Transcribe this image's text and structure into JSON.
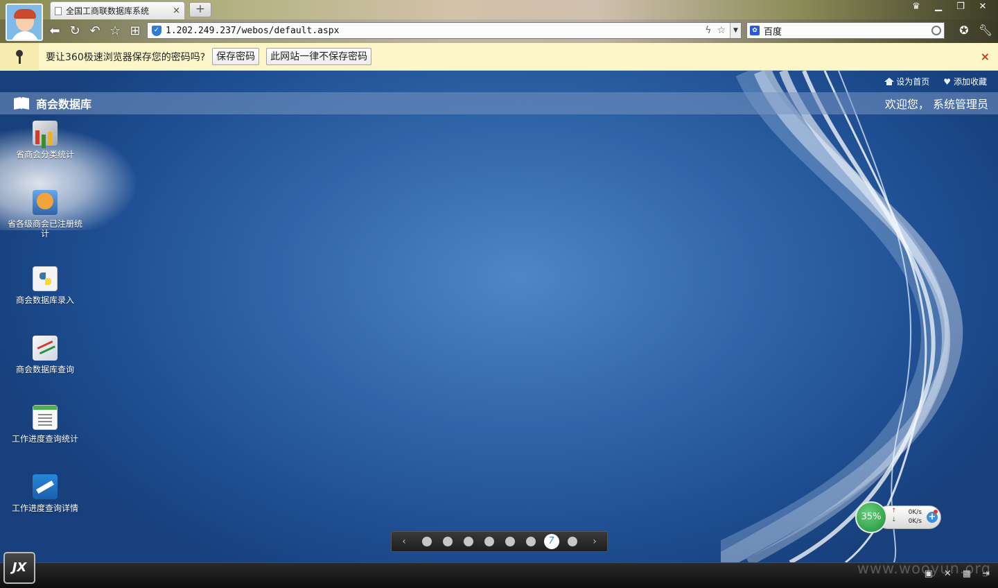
{
  "browser": {
    "tab_title": "全国工商联数据库系统",
    "tab_close": "×",
    "new_tab": "+",
    "url": "1.202.249.237/webos/default.aspx",
    "search_engine": "百度",
    "window_controls": [
      "shirt-icon",
      "minimize-icon",
      "restore-icon",
      "close-icon"
    ]
  },
  "infobar": {
    "message": "要让360极速浏览器保存您的密码吗?",
    "save_button": "保存密码",
    "never_button": "此网站一律不保存密码",
    "close": "×"
  },
  "desktop": {
    "top_links": {
      "set_home": "设为首页",
      "add_favorite": "添加收藏"
    },
    "app_title": "商会数据库",
    "welcome": "欢迎您， 系统管理员",
    "icons": [
      {
        "label": "省商会分类统计",
        "icon": "stats-chart-icon"
      },
      {
        "label": "省各级商会已注册统计",
        "icon": "registration-stats-icon"
      },
      {
        "label": "商会数据库录入",
        "icon": "python-entry-icon"
      },
      {
        "label": "商会数据库查询",
        "icon": "query-chart-icon"
      },
      {
        "label": "工作进度查询统计",
        "icon": "document-icon"
      },
      {
        "label": "工作进度查询详情",
        "icon": "detail-icon"
      }
    ],
    "pager": {
      "prev": "‹",
      "next": "›",
      "active_page": "7",
      "page_count": 8
    }
  },
  "netwidget": {
    "percent": "35%",
    "upload": "0K/s",
    "download": "0K/s"
  },
  "taskbar": {
    "start_label": "JX",
    "watermark": "www.wooyun.org"
  }
}
